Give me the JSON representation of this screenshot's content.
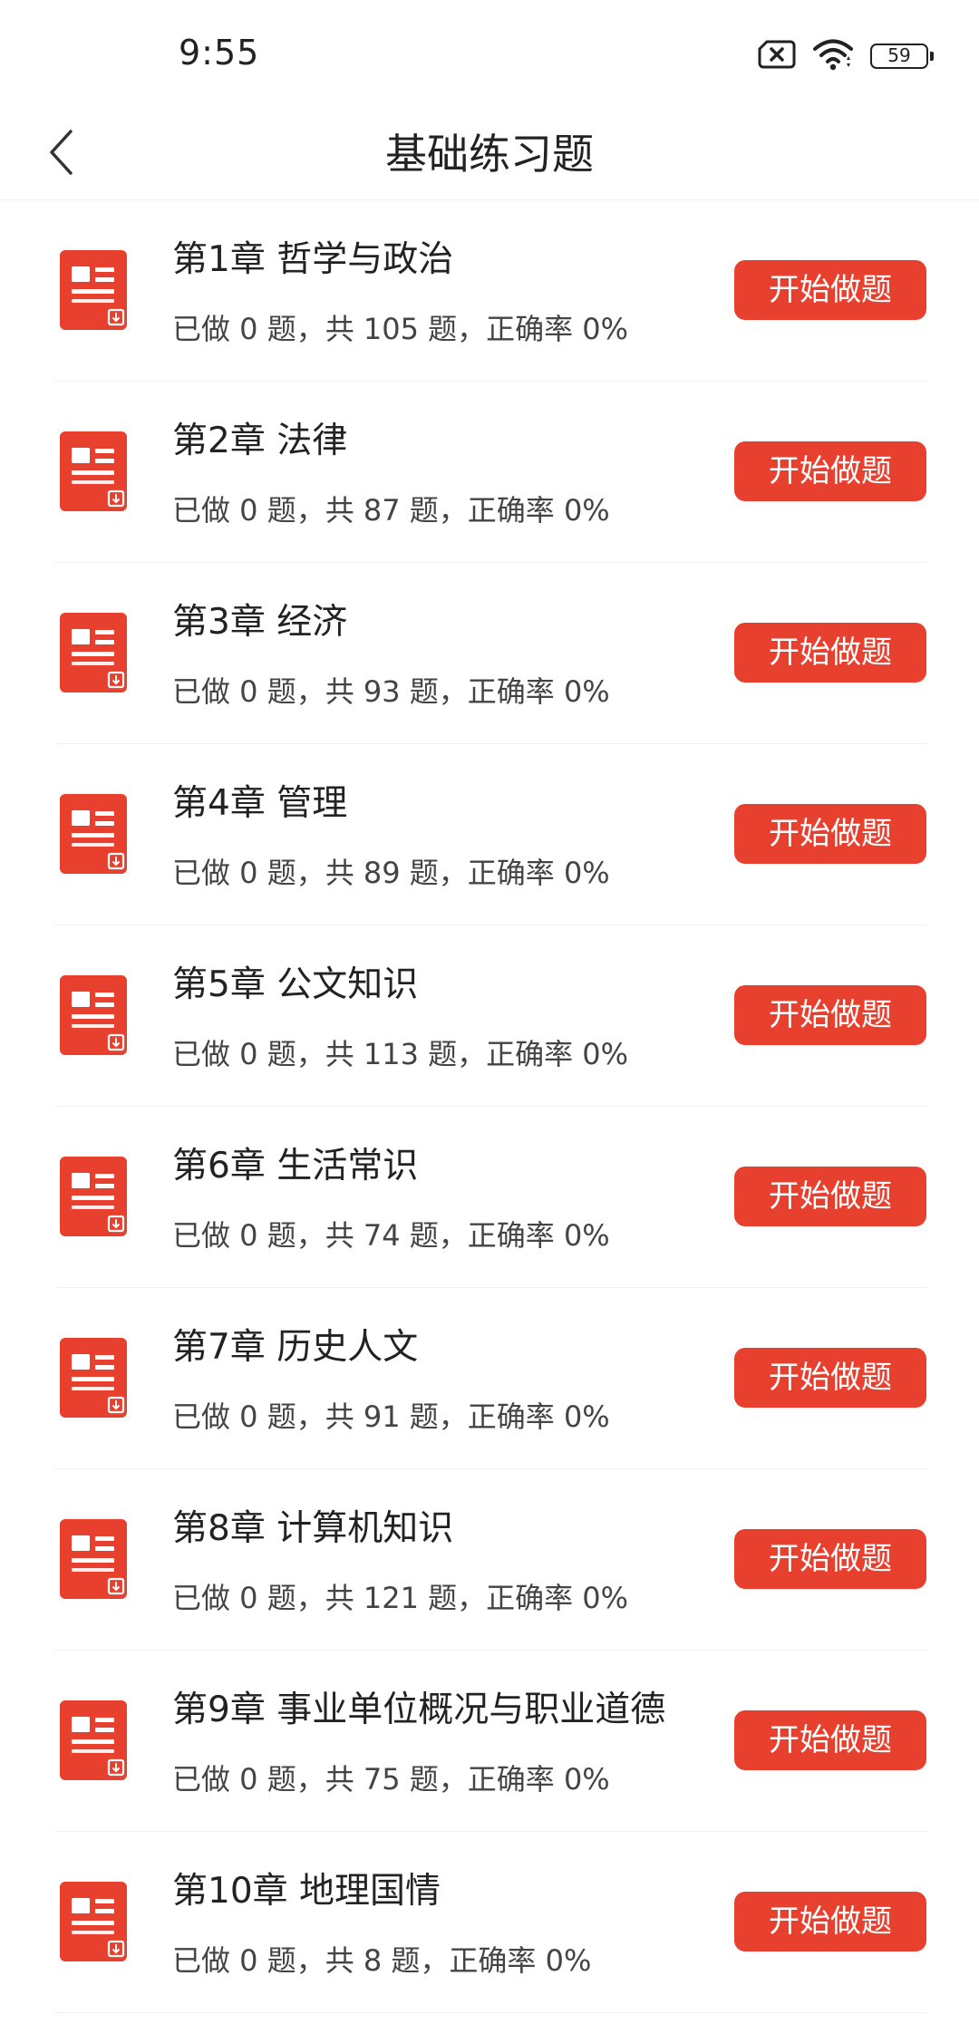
{
  "status_bar": {
    "time": "9:55",
    "battery_level": "59",
    "icons": [
      "sim-error-icon",
      "wifi-icon",
      "battery-icon"
    ]
  },
  "header": {
    "title": "基础练习题",
    "back_icon": "chevron-left-icon"
  },
  "colors": {
    "accent": "#e8402e",
    "divider": "#efefef",
    "text_primary": "#222222"
  },
  "chapters": [
    {
      "title": "第1章 哲学与政治",
      "stats": "已做 0 题，共 105 题，正确率 0%",
      "button": "开始做题"
    },
    {
      "title": "第2章 法律",
      "stats": "已做 0 题，共 87 题，正确率 0%",
      "button": "开始做题"
    },
    {
      "title": "第3章 经济",
      "stats": "已做 0 题，共 93 题，正确率 0%",
      "button": "开始做题"
    },
    {
      "title": "第4章 管理",
      "stats": "已做 0 题，共 89 题，正确率 0%",
      "button": "开始做题"
    },
    {
      "title": "第5章 公文知识",
      "stats": "已做 0 题，共 113 题，正确率 0%",
      "button": "开始做题"
    },
    {
      "title": "第6章 生活常识",
      "stats": "已做 0 题，共 74 题，正确率 0%",
      "button": "开始做题"
    },
    {
      "title": "第7章 历史人文",
      "stats": "已做 0 题，共 91 题，正确率 0%",
      "button": "开始做题"
    },
    {
      "title": "第8章 计算机知识",
      "stats": "已做 0 题，共 121 题，正确率 0%",
      "button": "开始做题"
    },
    {
      "title": "第9章 事业单位概况与职业道德",
      "stats": "已做 0 题，共 75 题，正确率 0%",
      "button": "开始做题"
    },
    {
      "title": "第10章 地理国情",
      "stats": "已做 0 题，共 8 题，正确率 0%",
      "button": "开始做题"
    }
  ]
}
